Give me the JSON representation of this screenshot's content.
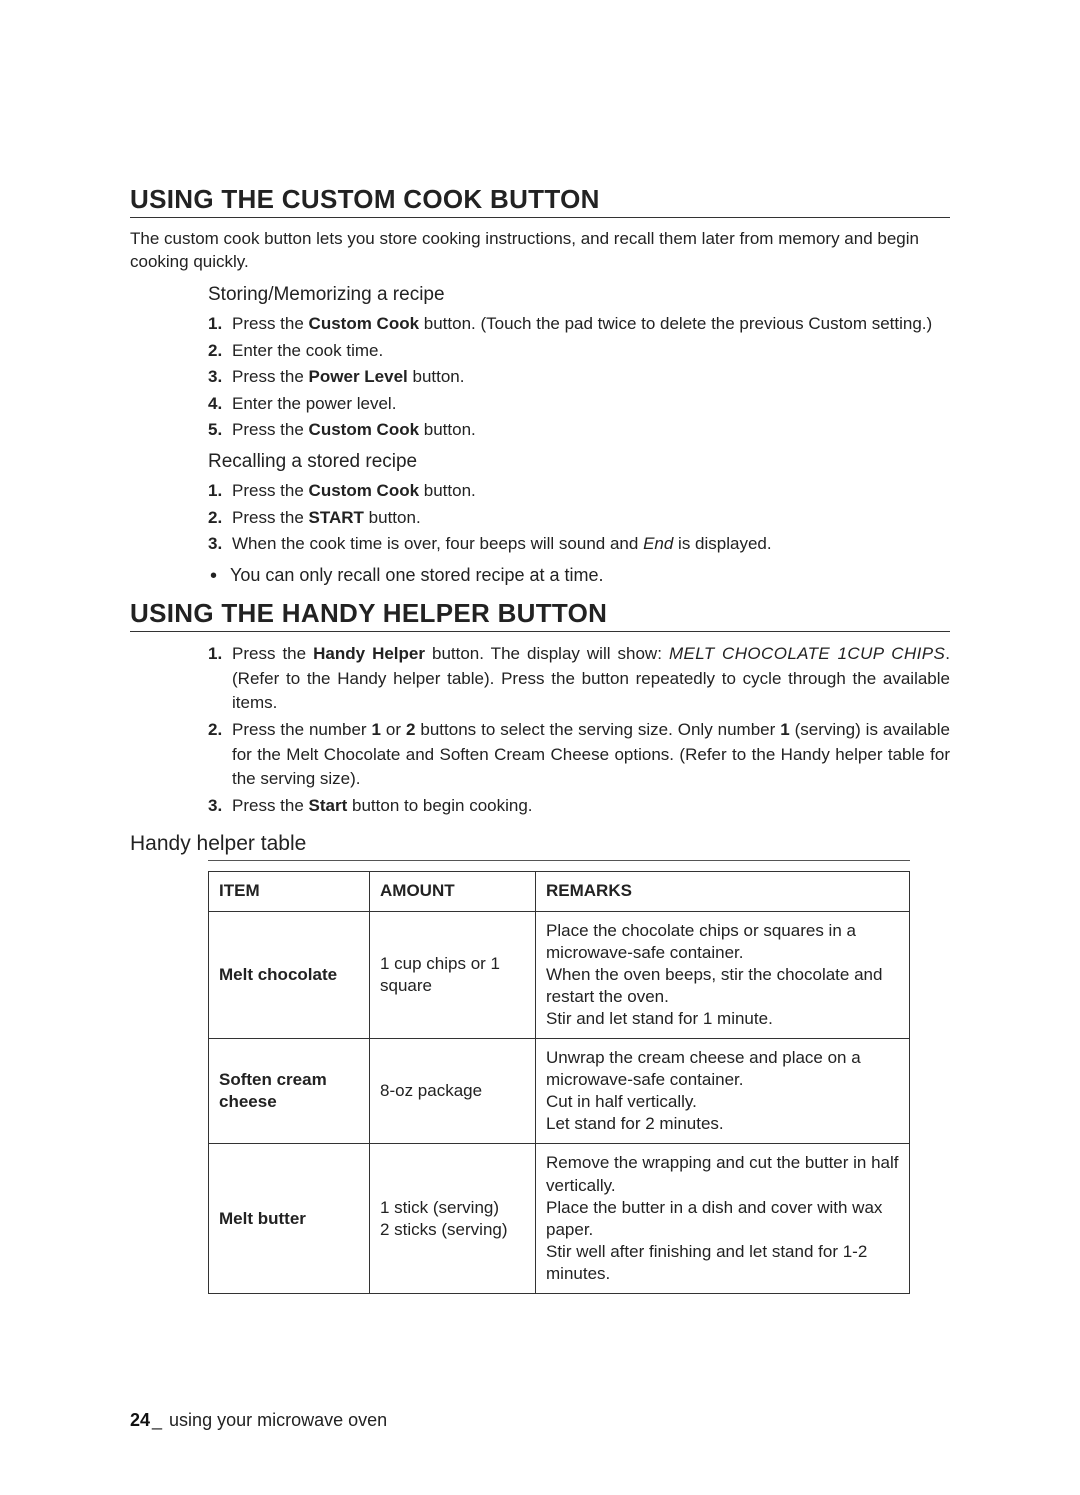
{
  "section1": {
    "heading": "USING THE CUSTOM COOK BUTTON",
    "intro": "The custom cook button lets you store cooking instructions, and recall them later from memory and begin cooking quickly.",
    "sub1_heading": "Storing/Memorizing a recipe",
    "sub1_steps": [
      {
        "num": "1.",
        "pre": "Press the ",
        "bold": "Custom Cook",
        "post": " button. (Touch the pad twice to delete the previous Custom setting.)"
      },
      {
        "num": "2.",
        "pre": "Enter the cook time.",
        "bold": "",
        "post": ""
      },
      {
        "num": "3.",
        "pre": "Press the ",
        "bold": "Power Level",
        "post": " button."
      },
      {
        "num": "4.",
        "pre": "Enter the power level.",
        "bold": "",
        "post": ""
      },
      {
        "num": "5.",
        "pre": "Press the ",
        "bold": "Custom Cook",
        "post": " button."
      }
    ],
    "sub2_heading": "Recalling a stored recipe",
    "sub2_steps": [
      {
        "num": "1.",
        "pre": "Press the ",
        "bold": "Custom Cook",
        "post": " button."
      },
      {
        "num": "2.",
        "pre": "Press the ",
        "bold": "START",
        "post": " button."
      },
      {
        "num": "3.",
        "pre": "When the cook time is over, four beeps will sound and ",
        "italic": "End",
        "post": " is displayed."
      }
    ],
    "bullet": "You can only recall one stored recipe at a time."
  },
  "section2": {
    "heading": "USING THE HANDY HELPER BUTTON",
    "steps": [
      {
        "num": "1.",
        "parts": {
          "t1": "Press the ",
          "b1": "Handy Helper",
          "t2": " button. The display will show: ",
          "i1": "MELT CHOCOLATE 1CUP CHIPS",
          "t3": ". (Refer to the Handy helper table). Press the button repeatedly to cycle through the available items."
        }
      },
      {
        "num": "2.",
        "parts": {
          "t1": "Press the number ",
          "b1": "1",
          "t2": " or ",
          "b2": "2",
          "t3": " buttons to select the serving size. Only number ",
          "b3": "1",
          "t4": " (serving) is available for the Melt Chocolate and Soften Cream Cheese options. (Refer to the Handy helper table for the serving size)."
        }
      },
      {
        "num": "3.",
        "parts": {
          "t1": "Press the ",
          "b1": "Start",
          "t2": " button to begin cooking."
        }
      }
    ],
    "table_heading": "Handy helper table",
    "table": {
      "headers": [
        "ITEM",
        "AMOUNT",
        "REMARKS"
      ],
      "rows": [
        {
          "item": "Melt chocolate",
          "amount": "1 cup chips or 1 square",
          "remarks": "Place the chocolate chips or squares in a microwave-safe container.\nWhen the oven beeps, stir the chocolate and restart the oven.\nStir and let stand for 1 minute."
        },
        {
          "item": "Soften cream cheese",
          "amount": "8-oz package",
          "remarks": "Unwrap the cream cheese and place on a microwave-safe container.\nCut in half vertically.\nLet stand for 2 minutes."
        },
        {
          "item": "Melt butter",
          "amount": "1 stick (serving)\n2 sticks (serving)",
          "remarks": "Remove the wrapping and cut the butter in half vertically.\nPlace the butter in a dish and cover with wax paper.\nStir well after finishing and let stand for 1-2 minutes."
        }
      ]
    }
  },
  "footer": {
    "pagenum": "24",
    "underscore": "_",
    "text": " using your microwave oven"
  }
}
